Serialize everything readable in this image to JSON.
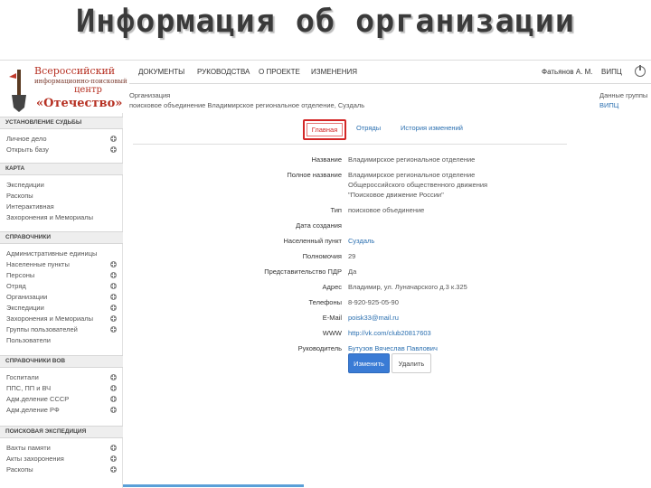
{
  "slide_title": "Информация об организации",
  "logo": {
    "line1": "Всероссийский",
    "line2": "информационно-поисковый",
    "line3": "центр",
    "line4": "«Отечество»"
  },
  "topnav": {
    "items": [
      "ДОКУМЕНТЫ",
      "РУКОВОДСТВА",
      "О ПРОЕКТЕ",
      "ИЗМЕНЕНИЯ"
    ],
    "user": "Фатьянов А. М.",
    "org": "ВИПЦ",
    "exit_icon": "power-icon"
  },
  "sidebar": {
    "sections": [
      {
        "title": "УСТАНОВЛЕНИЕ СУДЬБЫ",
        "items": [
          {
            "label": "Личное дело",
            "plus": true
          },
          {
            "label": "Открыть базу",
            "plus": true
          }
        ]
      },
      {
        "title": "КАРТА",
        "items": [
          {
            "label": "Экспедиции",
            "plus": false
          },
          {
            "label": "Раскопы",
            "plus": false
          },
          {
            "label": "Интерактивная",
            "plus": false
          },
          {
            "label": "Захоронения и Мемориалы",
            "plus": false
          }
        ]
      },
      {
        "title": "СПРАВОЧНИКИ",
        "items": [
          {
            "label": "Административные единицы",
            "plus": false
          },
          {
            "label": "Населенные пункты",
            "plus": true
          },
          {
            "label": "Персоны",
            "plus": true
          },
          {
            "label": "Отряд",
            "plus": true
          },
          {
            "label": "Организации",
            "plus": true
          },
          {
            "label": "Экспедиции",
            "plus": true
          },
          {
            "label": "Захоронения и Мемориалы",
            "plus": true
          },
          {
            "label": "Группы пользователей",
            "plus": true
          },
          {
            "label": "Пользователи",
            "plus": false
          }
        ]
      },
      {
        "title": "СПРАВОЧНИКИ ВОВ",
        "items": [
          {
            "label": "Госпитали",
            "plus": true
          },
          {
            "label": "ППС, ПП и ВЧ",
            "plus": true
          },
          {
            "label": "Адм.деление СССР",
            "plus": true
          },
          {
            "label": "Адм.деление РФ",
            "plus": true
          }
        ]
      },
      {
        "title": "ПОИСКОВАЯ ЭКСПЕДИЦИЯ",
        "items": [
          {
            "label": "Вахты памяти",
            "plus": true
          },
          {
            "label": "Акты захоронения",
            "plus": true
          },
          {
            "label": "Раскопы",
            "plus": true
          }
        ]
      }
    ]
  },
  "main": {
    "crumb_label": "Организация",
    "crumb_value": "поисковое объединение Владимирское региональное отделение, Суздаль",
    "side_label": "Данные группы",
    "side_value": "ВИПЦ",
    "tabs": [
      "Главная",
      "Отряды",
      "История изменений"
    ],
    "active_tab": 0,
    "fields": [
      {
        "label": "Название",
        "value": "Владимирское региональное отделение",
        "link": false
      },
      {
        "label": "Полное название",
        "value": "Владимирское региональное отделение",
        "value2": "Общероссийского общественного движения",
        "value3": "\"Поисковое движение России\"",
        "link": false
      },
      {
        "label": "Тип",
        "value": "поисковое объединение",
        "link": false
      },
      {
        "label": "Дата создания",
        "value": "",
        "link": false
      },
      {
        "label": "Населенный пункт",
        "value": "Суздаль",
        "link": true
      },
      {
        "label": "Полномочия",
        "value": "29",
        "link": false
      },
      {
        "label": "Представительство ПДР",
        "value": "Да",
        "link": false
      },
      {
        "label": "Адрес",
        "value": "Владимир, ул. Луначарского д.3 к.325",
        "link": false
      },
      {
        "label": "Телефоны",
        "value": "8-920-925-05-90",
        "link": false
      },
      {
        "label": "E-Mail",
        "value": "poisk33@mail.ru",
        "link": true
      },
      {
        "label": "WWW",
        "value": "http://vk.com/club20817603",
        "link": true
      },
      {
        "label": "Руководитель",
        "value": "Бутузов Вячеслав Павлович",
        "link": true
      }
    ],
    "edit_button": "Изменить",
    "delete_button": "Удалить"
  },
  "colors": {
    "accent": "#3a7bd5",
    "highlight": "#d32626",
    "logo_red": "#b63022",
    "link": "#2a6fb0"
  }
}
